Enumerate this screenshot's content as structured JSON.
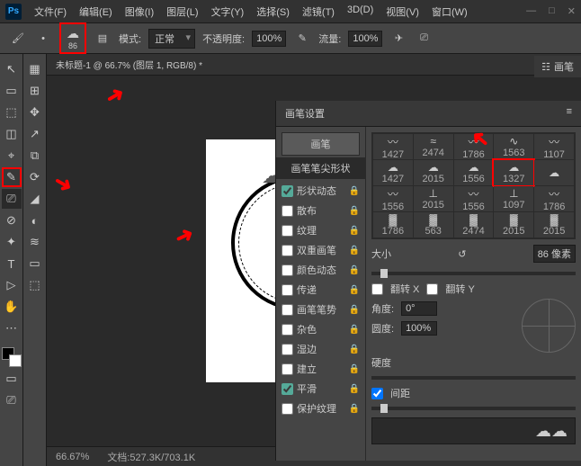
{
  "app": {
    "logo": "Ps"
  },
  "menu": [
    "文件(F)",
    "编辑(E)",
    "图像(I)",
    "图层(L)",
    "文字(Y)",
    "选择(S)",
    "滤镜(T)",
    "3D(D)",
    "视图(V)",
    "窗口(W)"
  ],
  "winbtns": {
    "min": "—",
    "max": "□",
    "close": "✕"
  },
  "optbar": {
    "brush_size": "86",
    "mode_label": "模式:",
    "mode_value": "正常",
    "opacity_label": "不透明度:",
    "opacity_value": "100%",
    "flow_label": "流量:",
    "flow_value": "100%"
  },
  "doc_tab": "未标题-1 @ 66.7% (图层 1, RGB/8) *",
  "status": {
    "zoom": "66.67%",
    "doc_label": "文档:",
    "doc_size": "527.3K/703.1K"
  },
  "tools_left": [
    "↖",
    "▭",
    "⬚",
    "◫",
    "⌖",
    "✂",
    "✎",
    "⎚",
    "⊘",
    "✦",
    "⌫",
    "T",
    "▷",
    "✋",
    "🔍"
  ],
  "tools_left2": [
    "▦",
    "⊞",
    "✥",
    "↗",
    "⧉",
    "⟳",
    "◢",
    "◐",
    "≋",
    "▭",
    "⬚"
  ],
  "right_tab": "画笔",
  "panel": {
    "title": "画笔设置",
    "btn_brush": "画笔",
    "header": "画笔笔尖形状",
    "options": [
      {
        "label": "形状动态",
        "checked": true
      },
      {
        "label": "散布",
        "checked": false
      },
      {
        "label": "纹理",
        "checked": false
      },
      {
        "label": "双重画笔",
        "checked": false
      },
      {
        "label": "颜色动态",
        "checked": false
      },
      {
        "label": "传递",
        "checked": false
      },
      {
        "label": "画笔笔势",
        "checked": false
      },
      {
        "label": "杂色",
        "checked": false
      },
      {
        "label": "湿边",
        "checked": false
      },
      {
        "label": "建立",
        "checked": false
      },
      {
        "label": "平滑",
        "checked": true
      },
      {
        "label": "保护纹理",
        "checked": false
      }
    ],
    "brushes": [
      {
        "s": "〰",
        "n": "1427"
      },
      {
        "s": "≈",
        "n": "2474"
      },
      {
        "s": "〰",
        "n": "1786"
      },
      {
        "s": "∿",
        "n": "1563"
      },
      {
        "s": "〰",
        "n": "1107"
      },
      {
        "s": "☁",
        "n": "1427"
      },
      {
        "s": "☁",
        "n": "2015"
      },
      {
        "s": "☁",
        "n": "1556"
      },
      {
        "s": "☁",
        "n": "1327",
        "hl": true
      },
      {
        "s": "☁",
        "n": ""
      },
      {
        "s": "〰",
        "n": "1556"
      },
      {
        "s": "⊥",
        "n": "2015"
      },
      {
        "s": "〰",
        "n": "1556"
      },
      {
        "s": "⊥",
        "n": "1097"
      },
      {
        "s": "〰",
        "n": "1786"
      },
      {
        "s": "▓",
        "n": "1786"
      },
      {
        "s": "▓",
        "n": "563"
      },
      {
        "s": "▓",
        "n": "2474"
      },
      {
        "s": "▓",
        "n": "2015"
      },
      {
        "s": "▓",
        "n": "2015"
      }
    ],
    "size_label": "大小",
    "size_value": "86 像素",
    "flipx": "翻转 X",
    "flipy": "翻转 Y",
    "angle_label": "角度:",
    "angle_value": "0°",
    "round_label": "圆度:",
    "round_value": "100%",
    "hardness_label": "硬度",
    "spacing_label": "间距"
  }
}
